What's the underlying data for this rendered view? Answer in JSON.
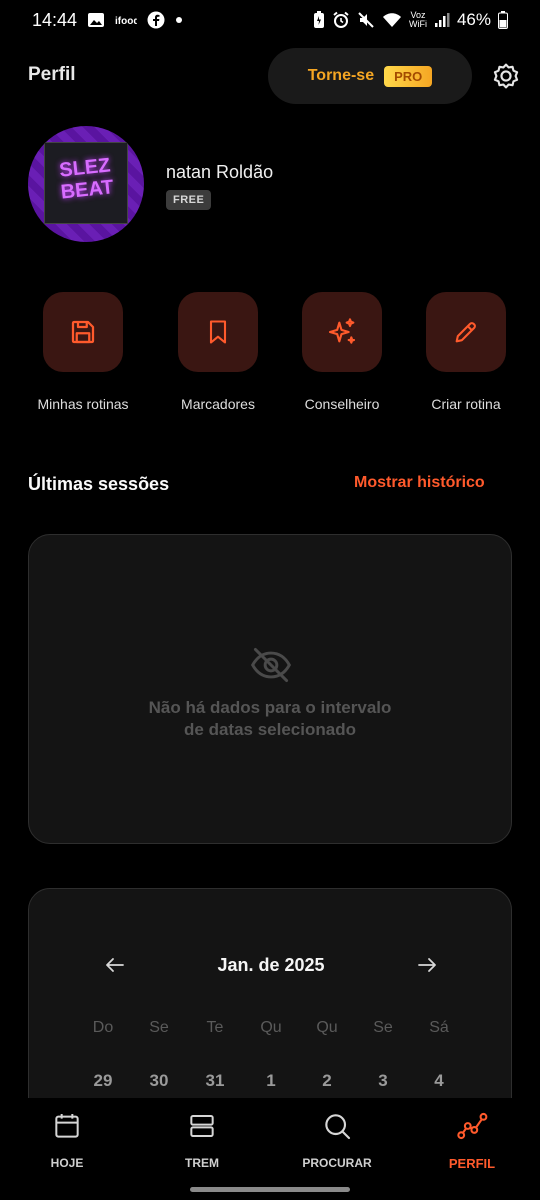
{
  "status_bar": {
    "time": "14:44",
    "network_label_top": "Voz",
    "network_label_bottom": "WiFi",
    "battery": "46%"
  },
  "header": {
    "title": "Perfil",
    "pro_label": "Torne-se",
    "pro_badge": "PRO"
  },
  "profile": {
    "avatar_text_top": "SLEZ",
    "avatar_text_bottom": "BEAT",
    "name": "natan Roldão",
    "plan": "FREE"
  },
  "quick_actions": [
    {
      "label": "Minhas rotinas",
      "icon": "save-icon"
    },
    {
      "label": "Marcadores",
      "icon": "bookmark-icon"
    },
    {
      "label": "Conselheiro",
      "icon": "sparkles-icon"
    },
    {
      "label": "Criar rotina",
      "icon": "pencil-icon"
    }
  ],
  "sessions": {
    "title": "Últimas sessões",
    "history_link": "Mostrar histórico",
    "empty_line1": "Não há dados para o intervalo",
    "empty_line2": "de datas selecionado"
  },
  "calendar": {
    "month": "Jan. de 2025",
    "weekdays": [
      "Do",
      "Se",
      "Te",
      "Qu",
      "Qu",
      "Se",
      "Sá"
    ],
    "days": [
      "29",
      "30",
      "31",
      "1",
      "2",
      "3",
      "4"
    ]
  },
  "bottom_nav": [
    {
      "label": "HOJE",
      "icon": "calendar-icon",
      "active": false
    },
    {
      "label": "TREM",
      "icon": "layers-icon",
      "active": false
    },
    {
      "label": "PROCURAR",
      "icon": "search-icon",
      "active": false
    },
    {
      "label": "PERFIL",
      "icon": "chart-line-icon",
      "active": true
    }
  ],
  "colors": {
    "accent": "#ff5a2c",
    "pro": "#f5a623",
    "action_bg": "#3a1612",
    "card_bg": "#141414"
  }
}
